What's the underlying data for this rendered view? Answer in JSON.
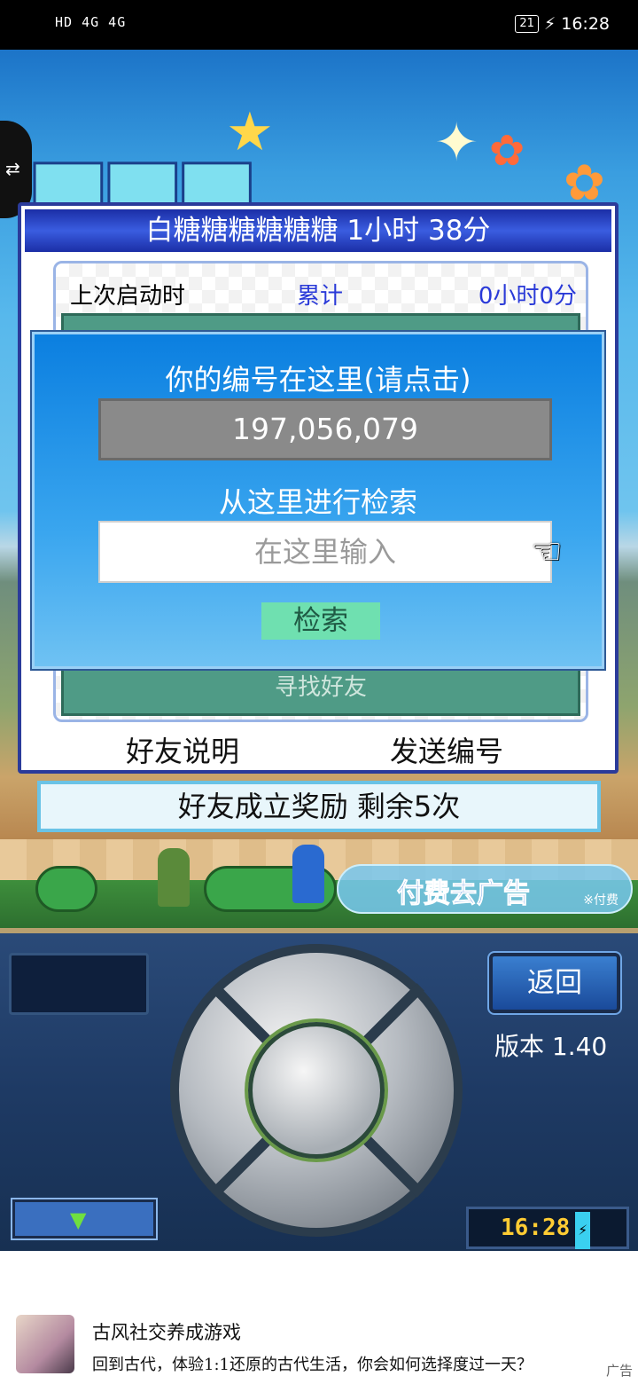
{
  "status_bar": {
    "left": "HD 4G 4G",
    "battery": "21",
    "time": "16:28"
  },
  "dialog": {
    "title": "白糖糖糖糖糖糖  1小时 38分",
    "last_launch_label": "上次启动时",
    "total_label": "累计",
    "total_value": "0小时0分",
    "find_friends_label": "寻找好友",
    "friend_explain": "好友说明",
    "send_id": "发送编号"
  },
  "popup": {
    "id_heading": "你的编号在这里(请点击)",
    "id_value": "197,056,079",
    "search_heading": "从这里进行检索",
    "search_placeholder": "在这里输入",
    "search_button": "检索"
  },
  "reward_banner": "好友成立奖励  剩余5次",
  "remove_ads": {
    "label": "付费去广告",
    "sub": "※付费"
  },
  "controller": {
    "back_label": "返回",
    "version": "版本 1.40",
    "clock": "16:28"
  },
  "ad": {
    "title": "古风社交养成游戏",
    "description": "回到古代，体验1:1还原的古代生活，你会如何选择度过一天？",
    "tag": "广告"
  }
}
